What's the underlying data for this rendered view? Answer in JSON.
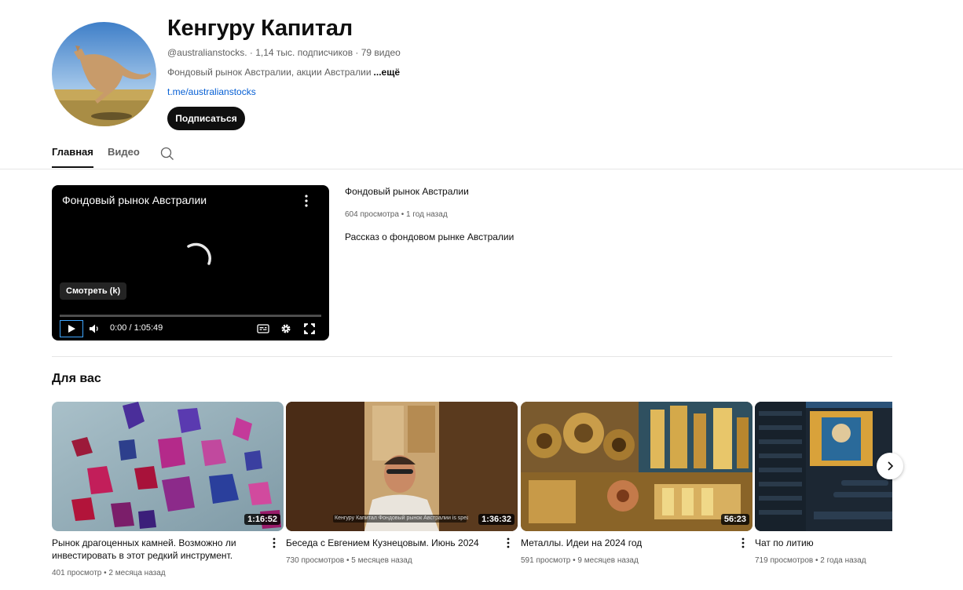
{
  "channel": {
    "name": "Кенгуру Капитал",
    "meta": "@australianstocks. · 1,14 тыс. подписчиков · 79 видео",
    "description": "Фондовый рынок Австралии, акции Австралии",
    "more_label": "...ещё",
    "link": "t.me/australianstocks",
    "subscribe_label": "Подписаться"
  },
  "tabs": [
    {
      "label": "Главная",
      "active": true
    },
    {
      "label": "Видео",
      "active": false
    }
  ],
  "featured": {
    "player_title": "Фондовый рынок Австралии",
    "watch_label": "Смотреть (k)",
    "time": "0:00 / 1:05:49",
    "title": "Фондовый рынок Австралии",
    "meta": "604 просмотра • 1 год назад",
    "description": "Рассказ о фондовом рынке Австралии"
  },
  "section_title": "Для вас",
  "cards": [
    {
      "title": "Рынок драгоценных камней. Возможно ли инвестировать в этот редкий инструмент.",
      "meta": "401 просмотр • 2 месяца назад",
      "duration": "1:16:52"
    },
    {
      "title": "Беседа с Евгением Кузнецовым. Июнь 2024",
      "meta": "730 просмотров • 5 месяцев назад",
      "duration": "1:36:32",
      "overlay": "Кенгуру Капитал Фондовый рынок Австралии is speaking"
    },
    {
      "title": "Металлы. Идеи на 2024 год",
      "meta": "591 просмотр • 9 месяцев назад",
      "duration": "56:23"
    },
    {
      "title": "Чат по литию",
      "meta": "719 просмотров • 2 года назад",
      "duration": ""
    }
  ],
  "colors": {
    "accent": "#065fd4",
    "text": "#0f0f0f",
    "secondary": "#606060"
  }
}
